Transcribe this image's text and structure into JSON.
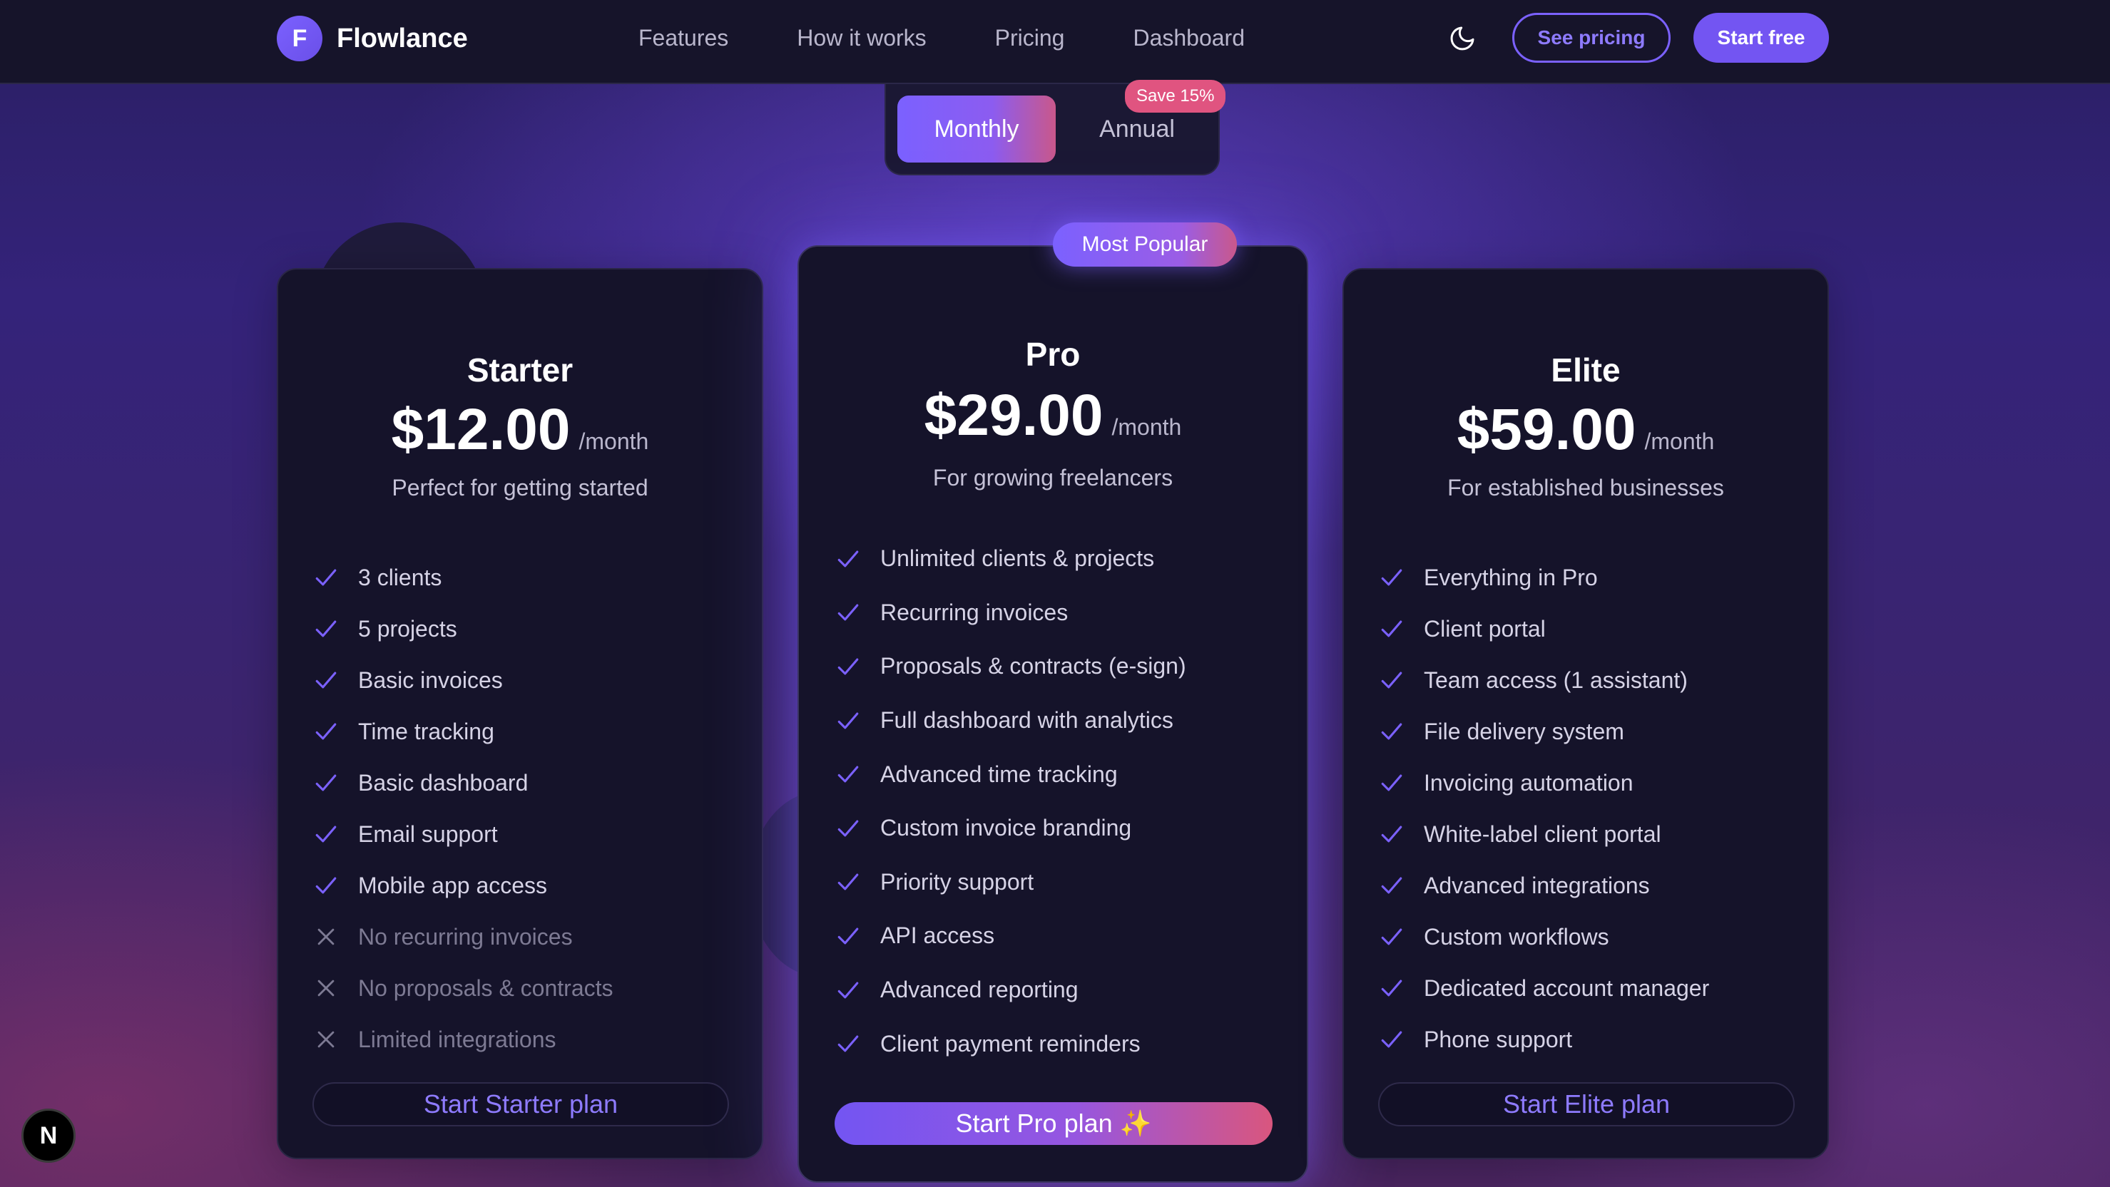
{
  "nav": {
    "logo_letter": "F",
    "brand": "Flowlance",
    "links": [
      "Features",
      "How it works",
      "Pricing",
      "Dashboard"
    ],
    "see_pricing": "See pricing",
    "start_free": "Start free"
  },
  "billing": {
    "monthly": "Monthly",
    "annual": "Annual",
    "save_badge": "Save 15%",
    "selected": "Monthly"
  },
  "plans": {
    "starter": {
      "name": "Starter",
      "price": "$12.00",
      "period": "/month",
      "tagline": "Perfect for getting started",
      "features": [
        {
          "text": "3 clients",
          "included": true
        },
        {
          "text": "5 projects",
          "included": true
        },
        {
          "text": "Basic invoices",
          "included": true
        },
        {
          "text": "Time tracking",
          "included": true
        },
        {
          "text": "Basic dashboard",
          "included": true
        },
        {
          "text": "Email support",
          "included": true
        },
        {
          "text": "Mobile app access",
          "included": true
        },
        {
          "text": "No recurring invoices",
          "included": false
        },
        {
          "text": "No proposals & contracts",
          "included": false
        },
        {
          "text": "Limited integrations",
          "included": false
        }
      ],
      "cta": "Start Starter plan"
    },
    "pro": {
      "badge": "Most Popular",
      "name": "Pro",
      "price": "$29.00",
      "period": "/month",
      "tagline": "For growing freelancers",
      "features": [
        {
          "text": "Unlimited clients & projects",
          "included": true
        },
        {
          "text": "Recurring invoices",
          "included": true
        },
        {
          "text": "Proposals & contracts (e-sign)",
          "included": true
        },
        {
          "text": "Full dashboard with analytics",
          "included": true
        },
        {
          "text": "Advanced time tracking",
          "included": true
        },
        {
          "text": "Custom invoice branding",
          "included": true
        },
        {
          "text": "Priority support",
          "included": true
        },
        {
          "text": "API access",
          "included": true
        },
        {
          "text": "Advanced reporting",
          "included": true
        },
        {
          "text": "Client payment reminders",
          "included": true
        }
      ],
      "cta": "Start Pro plan ✨"
    },
    "elite": {
      "name": "Elite",
      "price": "$59.00",
      "period": "/month",
      "tagline": "For established businesses",
      "features": [
        {
          "text": "Everything in Pro",
          "included": true
        },
        {
          "text": "Client portal",
          "included": true
        },
        {
          "text": "Team access (1 assistant)",
          "included": true
        },
        {
          "text": "File delivery system",
          "included": true
        },
        {
          "text": "Invoicing automation",
          "included": true
        },
        {
          "text": "White-label client portal",
          "included": true
        },
        {
          "text": "Advanced integrations",
          "included": true
        },
        {
          "text": "Custom workflows",
          "included": true
        },
        {
          "text": "Dedicated account manager",
          "included": true
        },
        {
          "text": "Phone support",
          "included": true
        }
      ],
      "cta": "Start Elite plan"
    }
  },
  "dev_badge": "N",
  "colors": {
    "accent": "#7b61ff",
    "pink": "#e05480",
    "card_bg": "#15132a",
    "nav_bg": "#16142a"
  },
  "icons": {
    "included": "check-icon",
    "excluded": "x-icon",
    "theme": "moon-icon"
  }
}
